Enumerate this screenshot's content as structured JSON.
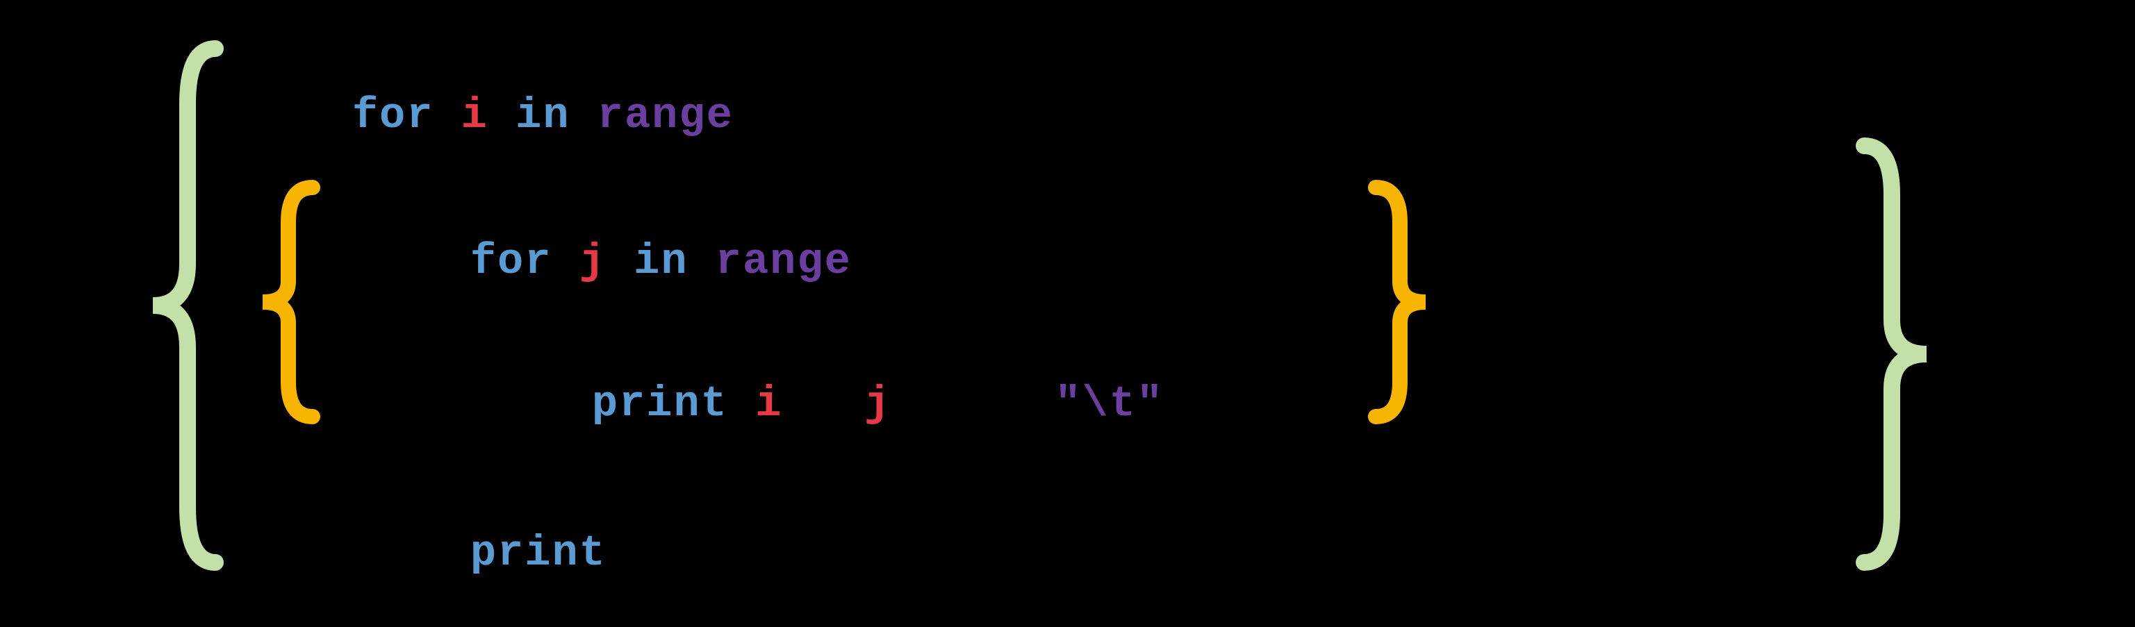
{
  "code": {
    "line1": {
      "for": "for",
      "var": "i",
      "in": "in",
      "range": "range"
    },
    "line2": {
      "for": "for",
      "var": "j",
      "in": "in",
      "range": "range"
    },
    "line3": {
      "print": "print",
      "var1": "i",
      "var2": "j",
      "str": "\"\\t\""
    },
    "line4": {
      "print": "print"
    }
  },
  "colors": {
    "background": "#000000",
    "keyword_blue": "#5a9bd4",
    "keyword_purple": "#6b3fa0",
    "variable_red": "#e63946",
    "outer_brace": "#c3e0a8",
    "inner_brace": "#f8b500"
  }
}
